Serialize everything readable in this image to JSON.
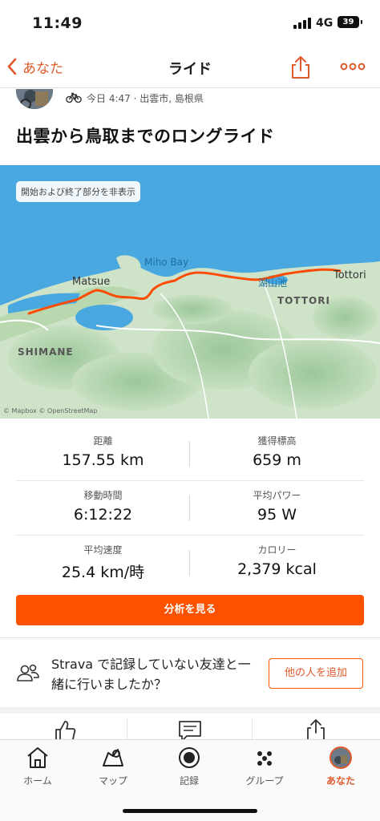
{
  "status": {
    "time": "11:49",
    "network": "4G",
    "battery": "39"
  },
  "nav": {
    "back_label": "あなた",
    "title": "ライド"
  },
  "activity": {
    "meta": "今日 4:47 · 出雲市, 島根県",
    "title": "出雲から鳥取までのロングライド",
    "sport_icon": "bike-icon"
  },
  "map": {
    "toggle_label": "開始および終了部分を非表示",
    "places": {
      "matsue": "Matsue",
      "tottori": "Tottori",
      "miho_bay": "Miho Bay",
      "lake": "湖山池"
    },
    "regions": {
      "shimane": "SHIMANE",
      "tottori_pref": "TOTTORI"
    },
    "attribution": "© Mapbox © OpenStreetMap",
    "route_color": "#fc4c02"
  },
  "stats": [
    {
      "left": {
        "label": "距離",
        "value": "157.55 km"
      },
      "right": {
        "label": "獲得標高",
        "value": "659 m"
      }
    },
    {
      "left": {
        "label": "移動時間",
        "value": "6:12:22"
      },
      "right": {
        "label": "平均パワー",
        "value": "95 W"
      }
    },
    {
      "left": {
        "label": "平均速度",
        "value": "25.4 km/時"
      },
      "right": {
        "label": "カロリー",
        "value": "2,379 kcal"
      }
    }
  ],
  "analyze_label": "分析を見る",
  "friends": {
    "text": "Strava で記録していない友達と一緒に行いましたか？",
    "button_label": "他の人を追加"
  },
  "actions": [
    "like-icon",
    "comment-icon",
    "share-icon"
  ],
  "tabs": [
    {
      "label": "ホーム",
      "icon": "home-icon"
    },
    {
      "label": "マップ",
      "icon": "map-icon"
    },
    {
      "label": "記録",
      "icon": "record-icon"
    },
    {
      "label": "グループ",
      "icon": "groups-icon"
    },
    {
      "label": "あなた",
      "icon": "avatar-icon",
      "active": true
    }
  ],
  "colors": {
    "brand": "#fc5200",
    "accent_text": "#e05a2b"
  }
}
